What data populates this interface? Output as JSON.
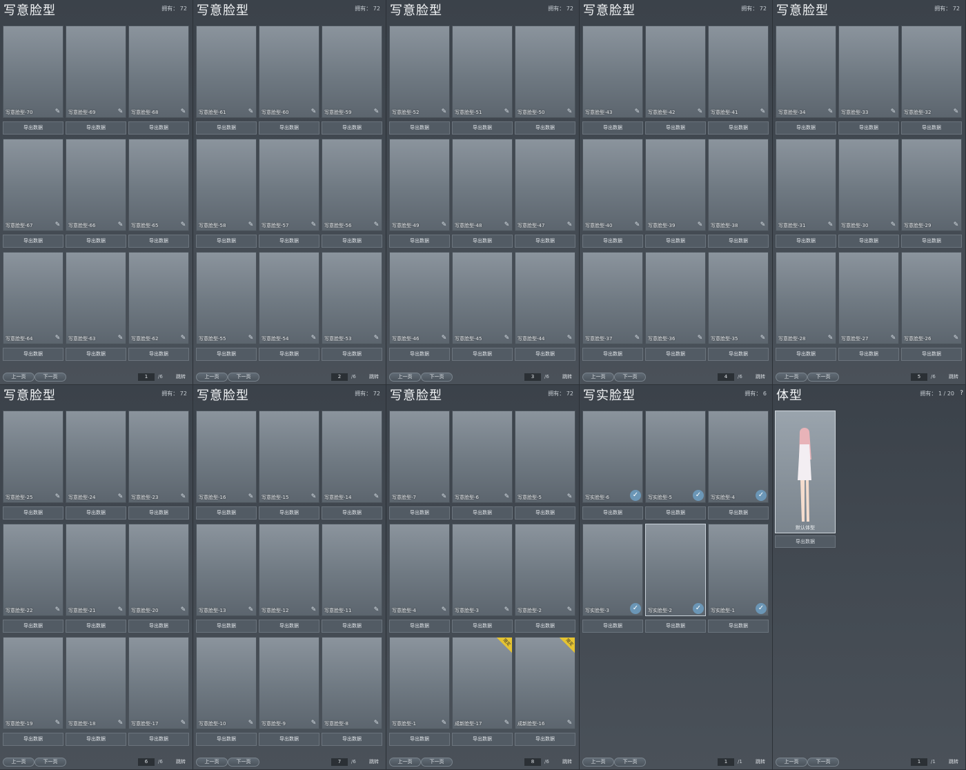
{
  "colors": {
    "hair": "#e8b3b8",
    "skin": "#f4dccd",
    "panel": "#3b424a",
    "check": "#6b96b6",
    "tag": "#e6c431"
  },
  "icons": {
    "edit": "pencil-icon",
    "check": "check-icon",
    "help": "question-icon"
  },
  "common": {
    "export_label": "导出数据",
    "prev_label": "上一页",
    "next_label": "下一页",
    "jump_label": "跳转"
  },
  "panels": [
    {
      "title": "写意脸型",
      "count": "拥有： 72",
      "page": "1",
      "total": "/6",
      "items": [
        "写意脸型-70",
        "写意脸型-69",
        "写意脸型-68",
        "写意脸型-67",
        "写意脸型-66",
        "写意脸型-65",
        "写意脸型-64",
        "写意脸型-63",
        "写意脸型-62"
      ]
    },
    {
      "title": "写意脸型",
      "count": "拥有： 72",
      "page": "2",
      "total": "/6",
      "items": [
        "写意脸型-61",
        "写意脸型-60",
        "写意脸型-59",
        "写意脸型-58",
        "写意脸型-57",
        "写意脸型-56",
        "写意脸型-55",
        "写意脸型-54",
        "写意脸型-53"
      ]
    },
    {
      "title": "写意脸型",
      "count": "拥有： 72",
      "page": "3",
      "total": "/6",
      "items": [
        "写意脸型-52",
        "写意脸型-51",
        "写意脸型-50",
        "写意脸型-49",
        "写意脸型-48",
        "写意脸型-47",
        "写意脸型-46",
        "写意脸型-45",
        "写意脸型-44"
      ]
    },
    {
      "title": "写意脸型",
      "count": "拥有： 72",
      "page": "4",
      "total": "/6",
      "items": [
        "写意脸型-43",
        "写意脸型-42",
        "写意脸型-41",
        "写意脸型-40",
        "写意脸型-39",
        "写意脸型-38",
        "写意脸型-37",
        "写意脸型-36",
        "写意脸型-35"
      ]
    },
    {
      "title": "写意脸型",
      "count": "拥有： 72",
      "page": "5",
      "total": "/6",
      "items": [
        "写意脸型-34",
        "写意脸型-33",
        "写意脸型-32",
        "写意脸型-31",
        "写意脸型-30",
        "写意脸型-29",
        "写意脸型-28",
        "写意脸型-27",
        "写意脸型-26"
      ]
    },
    {
      "title": "写意脸型",
      "count": "拥有： 72",
      "page": "6",
      "total": "/6",
      "items": [
        "写意脸型-25",
        "写意脸型-24",
        "写意脸型-23",
        "写意脸型-22",
        "写意脸型-21",
        "写意脸型-20",
        "写意脸型-19",
        "写意脸型-18",
        "写意脸型-17"
      ]
    },
    {
      "title": "写意脸型",
      "count": "拥有： 72",
      "page": "7",
      "total": "/6",
      "items": [
        "写意脸型-16",
        "写意脸型-15",
        "写意脸型-14",
        "写意脸型-13",
        "写意脸型-12",
        "写意脸型-11",
        "写意脸型-10",
        "写意脸型-9",
        "写意脸型-8"
      ]
    },
    {
      "title": "写意脸型",
      "count": "拥有： 72",
      "page": "8",
      "total": "/6",
      "items": [
        "写意脸型-7",
        "写意脸型-6",
        "写意脸型-5",
        "写意脸型-4",
        "写意脸型-3",
        "写意脸型-2",
        "写意脸型-1",
        "成新脸型-17",
        "成新脸型-16"
      ],
      "tag_label": "限定"
    },
    {
      "title": "写实脸型",
      "count": "拥有： 6",
      "page": "1",
      "total": "/1",
      "items": [
        "写实脸型-6",
        "写实脸型-5",
        "写实脸型-4",
        "写实脸型-3",
        "写实脸型-2",
        "写实脸型-1"
      ]
    },
    {
      "title": "体型",
      "count": "拥有： 1 / 20",
      "page": "1",
      "total": "/1",
      "body_item": "默认体型",
      "help": "?"
    }
  ]
}
